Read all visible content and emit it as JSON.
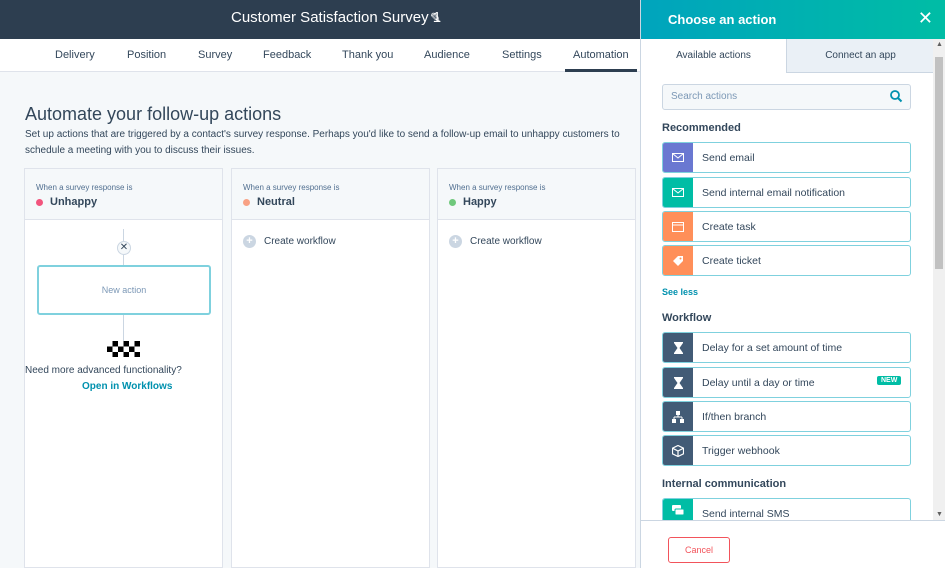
{
  "header": {
    "title": "Customer Satisfaction Survey 1",
    "edit_icon": "pencil-icon"
  },
  "tabs": [
    "Delivery",
    "Position",
    "Survey",
    "Feedback",
    "Thank you",
    "Audience",
    "Settings",
    "Automation"
  ],
  "main": {
    "title": "Automate your follow-up actions",
    "description": "Set up actions that are triggered by a contact's survey response. Perhaps you'd like to send a follow-up email to unhappy customers to schedule a meeting with you to discuss their issues."
  },
  "columns": [
    {
      "when": "When a survey response is",
      "response": "Unhappy",
      "color": "#f2547d"
    },
    {
      "when": "When a survey response is",
      "response": "Neutral",
      "color": "#f8a184"
    },
    {
      "when": "When a survey response is",
      "response": "Happy",
      "color": "#6fc87c"
    }
  ],
  "unhappy_col": {
    "new_action": "New action",
    "need_more": "Need more advanced functionality?",
    "open_workflows": "Open in Workflows"
  },
  "create_workflow": "Create workflow",
  "panel": {
    "title": "Choose an action",
    "tab_available": "Available actions",
    "tab_connect": "Connect an app",
    "search_placeholder": "Search actions",
    "recommended_title": "Recommended",
    "recommended": [
      {
        "label": "Send email",
        "color": "#6a78d1",
        "icon": "email-icon"
      },
      {
        "label": "Send internal email notification",
        "color": "#00bda5",
        "icon": "email-icon"
      },
      {
        "label": "Create task",
        "color": "#ff8f59",
        "icon": "task-icon"
      },
      {
        "label": "Create ticket",
        "color": "#ff8f59",
        "icon": "ticket-icon"
      }
    ],
    "see_less": "See less",
    "workflow_title": "Workflow",
    "workflow": [
      {
        "label": "Delay for a set amount of time",
        "color": "#425b76",
        "icon": "hourglass-icon"
      },
      {
        "label": "Delay until a day or time",
        "color": "#425b76",
        "icon": "hourglass-icon",
        "badge": "NEW"
      },
      {
        "label": "If/then branch",
        "color": "#425b76",
        "icon": "branch-icon"
      },
      {
        "label": "Trigger webhook",
        "color": "#425b76",
        "icon": "cube-icon"
      }
    ],
    "internal_title": "Internal communication",
    "internal": [
      {
        "label": "Send internal SMS",
        "color": "#00bda5",
        "icon": "sms-icon"
      }
    ],
    "cancel": "Cancel"
  }
}
